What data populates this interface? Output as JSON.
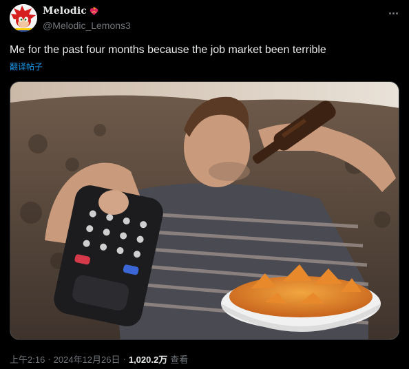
{
  "author": {
    "display_name": "Melodic",
    "handle": "@Melodic_Lemons3",
    "avatar_icon": "sonic-avatar-icon",
    "badge_icon": "heart-fire-icon"
  },
  "tweet": {
    "text": "Me for the past four months because the job market been terrible",
    "translate_label": "翻译帖子"
  },
  "media": {
    "description_icon": "photo-man-couch-remote-beer-chips"
  },
  "meta": {
    "time": "上午2:16",
    "separator": "·",
    "date": "2024年12月26日",
    "separator2": "·",
    "views_count": "1,020.2万",
    "views_label": "查看"
  },
  "colors": {
    "background": "#000000",
    "text": "#e7e9ea",
    "secondary": "#71767b",
    "link": "#1d9bf0"
  }
}
